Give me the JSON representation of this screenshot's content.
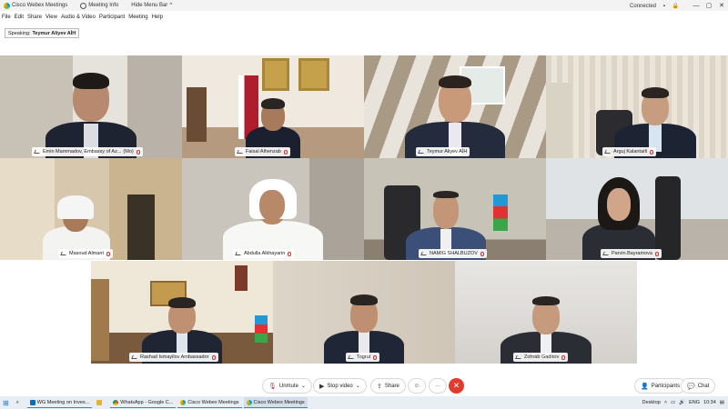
{
  "titlebar": {
    "app_title": "Cisco Webex Meetings",
    "meeting_info": "Meeting Info",
    "hide_menu": "Hide Menu Bar",
    "connected": "Connected"
  },
  "menu": [
    "File",
    "Edit",
    "Share",
    "View",
    "Audio & Video",
    "Participant",
    "Meeting",
    "Help"
  ],
  "speaking": {
    "label": "Speaking:",
    "name": "Teymur Aliyev AİH"
  },
  "participants": [
    {
      "name": "Emin Mammadov, Embassy of Az...",
      "badge": "(Mo)"
    },
    {
      "name": "Faisal Alhenzab"
    },
    {
      "name": "Teymur Aliyev AİH"
    },
    {
      "name": "Arguj Kalantarli"
    },
    {
      "name": "Masoud Almarri"
    },
    {
      "name": "Abdulla Alkhayarin"
    },
    {
      "name": "NAMIG SHALBUZOV"
    },
    {
      "name": "Parvin.Bayramova"
    },
    {
      "name": "Rashad Ismayilov Ambassador"
    },
    {
      "name": "Togrul"
    },
    {
      "name": "Zohrab Gadirov"
    }
  ],
  "controls": {
    "unmute": "Unmute",
    "stop_video": "Stop video",
    "share": "Share",
    "participants": "Participants",
    "chat": "Chat",
    "more": "···",
    "end": "✕"
  },
  "taskbar": {
    "apps": [
      "WG Meeting on Inves...",
      "WhatsApp - Google C...",
      "Cisco Webex Meetings",
      "Cisco Webex Meetings"
    ],
    "desktop": "Desktop",
    "lang": "ENG",
    "time": "10:34"
  }
}
